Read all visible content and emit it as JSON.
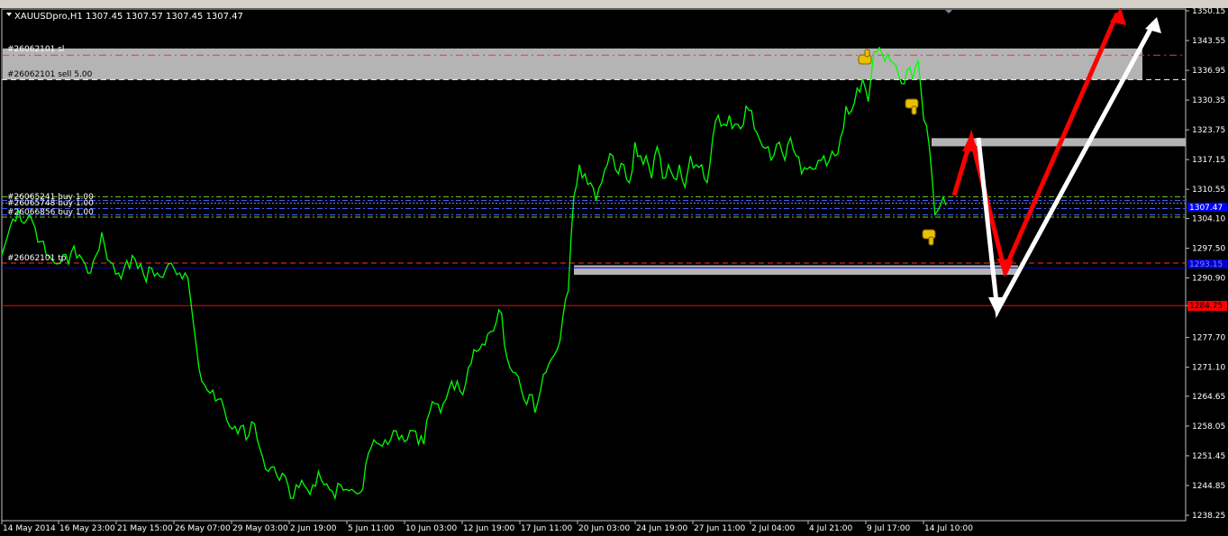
{
  "window": {
    "symbol_title": "XAUUSDpro,H1  1307.45 1307.57 1307.45 1307.47"
  },
  "colors": {
    "background": "#000000",
    "price_line": "#00ff00",
    "axis_text": "#ffffff",
    "zone_fill": "#b4b4b4",
    "support_line": "#ff0000",
    "sell_tp_line": "#0000cc",
    "buy_line": "#3333ff",
    "arrow_red": "#ff0000",
    "arrow_white": "#ffffff"
  },
  "orders": {
    "sl_label": "#26062101 sl",
    "sell_label": "#26062101 sell 5.00",
    "buy1_label": "#26065241 buy 1.00",
    "buy2_label": "#26065748 buy 1.00",
    "buy3_label": "#26066856 buy 1.00",
    "tp_label": "#26062101 tp"
  },
  "price_tags": {
    "current": "1307.47",
    "tp": "1293.15",
    "support": "1284.75"
  },
  "chart_data": {
    "type": "line",
    "title": "XAUUSDpro,H1  1307.45 1307.57 1307.45 1307.47",
    "xlabel": "",
    "ylabel": "",
    "ylim": [
      1238.25,
      1350.15
    ],
    "y_ticks": [
      "1350.15",
      "1343.55",
      "1336.95",
      "1330.35",
      "1323.75",
      "1317.15",
      "1310.55",
      "1304.10",
      "1297.50",
      "1290.90",
      "1284.75",
      "1277.70",
      "1271.10",
      "1264.65",
      "1258.05",
      "1251.45",
      "1244.85",
      "1238.25"
    ],
    "x_ticks": [
      "14 May 2014",
      "16 May 23:00",
      "21 May 15:00",
      "26 May 07:00",
      "29 May 03:00",
      "2 Jun 19:00",
      "5 Jun 11:00",
      "10 Jun 03:00",
      "12 Jun 19:00",
      "17 Jun 11:00",
      "20 Jun 03:00",
      "24 Jun 19:00",
      "27 Jun 11:00",
      "2 Jul 04:00",
      "4 Jul 21:00",
      "9 Jul 17:00",
      "14 Jul 10:00"
    ],
    "grid": false,
    "series": [
      {
        "values": [
          1296,
          1300,
          1304,
          1306,
          1303,
          1305,
          1302,
          1299,
          1296,
          1295,
          1294,
          1296,
          1294,
          1298,
          1296,
          1294,
          1292,
          1296,
          1301,
          1295,
          1294,
          1292,
          1293,
          1293,
          1295,
          1294,
          1290,
          1293,
          1292,
          1291,
          1294,
          1293,
          1292,
          1292,
          1286,
          1276,
          1268,
          1266,
          1266,
          1264,
          1262,
          1258,
          1258,
          1258,
          1255,
          1259,
          1255,
          1251,
          1248,
          1249,
          1246,
          1247,
          1242,
          1245,
          1246,
          1244,
          1245,
          1248,
          1245,
          1244,
          1242,
          1245,
          1244,
          1244,
          1243,
          1244,
          1252,
          1255,
          1254,
          1255,
          1255,
          1257,
          1256,
          1255,
          1257,
          1254,
          1254,
          1261,
          1263,
          1261,
          1264,
          1268,
          1268,
          1265,
          1271,
          1275,
          1275,
          1276,
          1279,
          1281,
          1283,
          1273,
          1270,
          1269,
          1264,
          1265,
          1261,
          1266,
          1270,
          1273,
          1275,
          1282,
          1288,
          1309,
          1316,
          1314,
          1312,
          1308,
          1312,
          1316,
          1318,
          1314,
          1316,
          1312,
          1321,
          1318,
          1318,
          1313,
          1320,
          1313,
          1316,
          1313,
          1316,
          1311,
          1318,
          1316,
          1316,
          1312,
          1322,
          1327,
          1325,
          1327,
          1325,
          1324,
          1329,
          1328,
          1323,
          1320,
          1320,
          1318,
          1321,
          1317,
          1322,
          1318,
          1314,
          1315,
          1315,
          1317,
          1318,
          1317,
          1318,
          1322,
          1329,
          1328,
          1333,
          1335,
          1330,
          1341,
          1342,
          1339,
          1339,
          1338,
          1334,
          1337,
          1335,
          1339,
          1326,
          1320,
          1305,
          1307,
          1307
        ]
      }
    ],
    "zones": [
      {
        "top": 1341.8,
        "bottom": 1334.9
      },
      {
        "top": 1321.9,
        "bottom": 1320.1
      },
      {
        "top": 1293.7,
        "bottom": 1291.6
      }
    ],
    "levels": [
      {
        "name": "sl",
        "value": 1340.3
      },
      {
        "name": "sell",
        "value": 1334.9
      },
      {
        "name": "buy",
        "value": 1308.1
      },
      {
        "name": "buy",
        "value": 1306.3
      },
      {
        "name": "buy",
        "value": 1304.9
      },
      {
        "name": "tp",
        "value": 1293.15
      },
      {
        "name": "support",
        "value": 1284.75
      },
      {
        "name": "current",
        "value": 1307.47
      }
    ]
  }
}
